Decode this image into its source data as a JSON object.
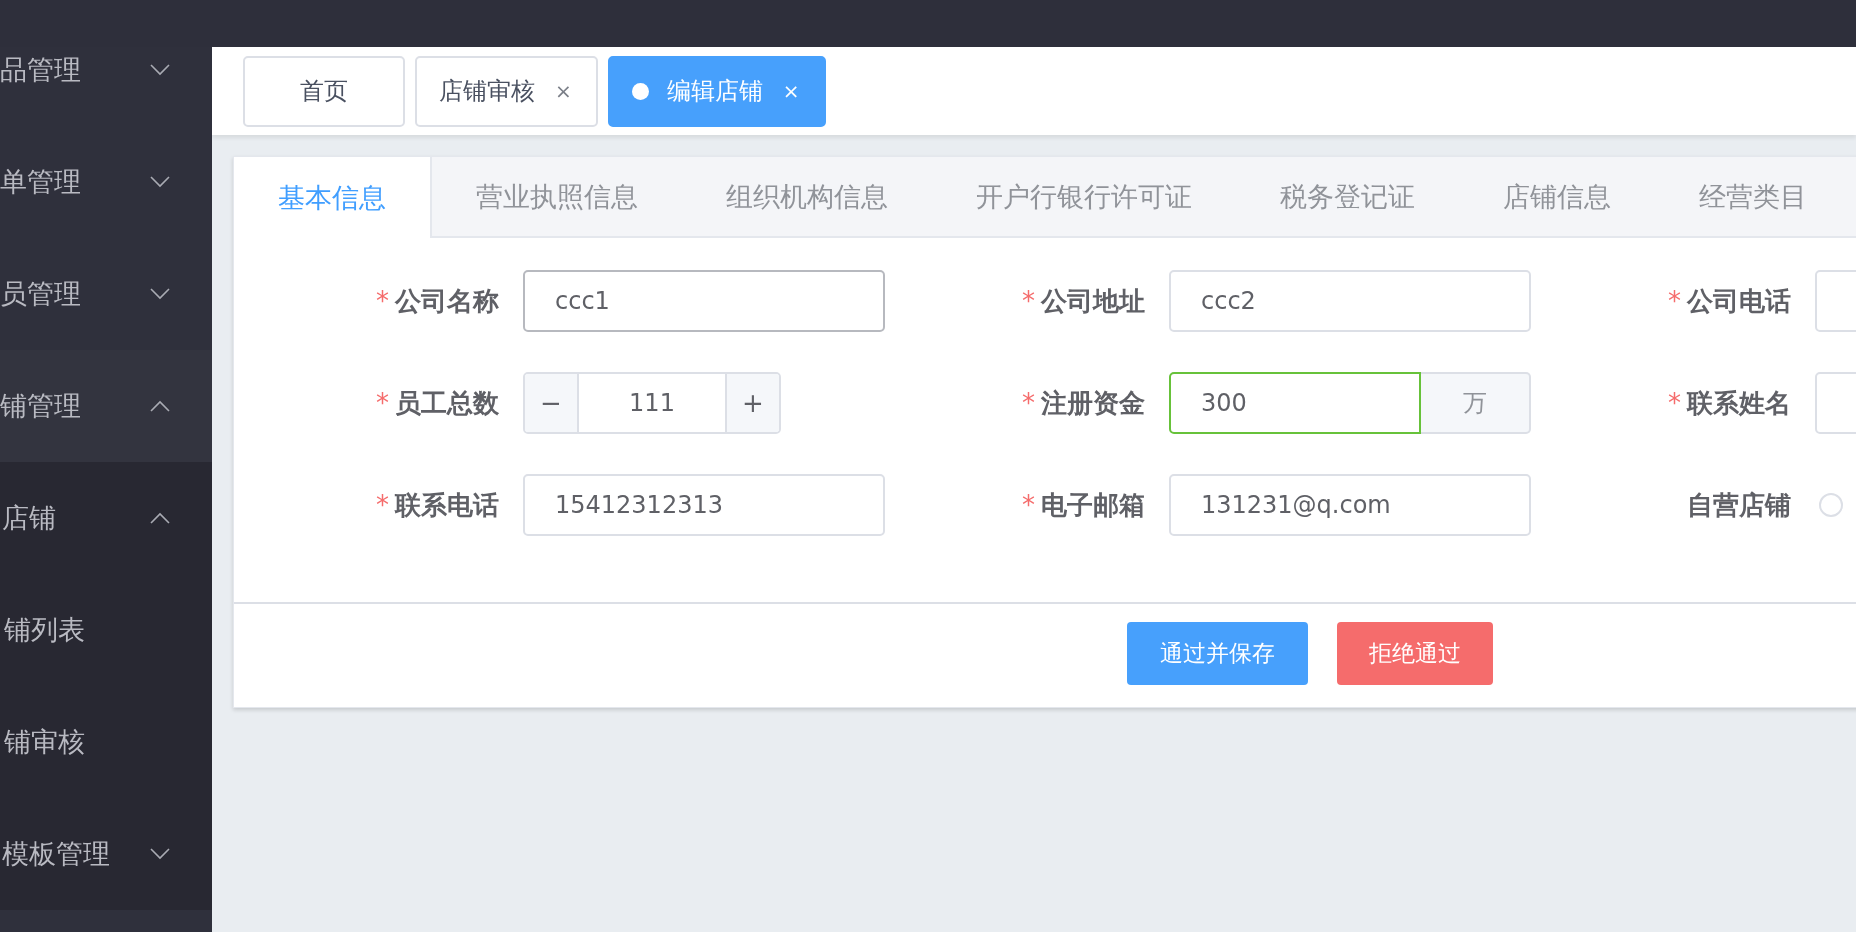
{
  "sidebar": {
    "items": [
      {
        "label": "品管理",
        "expanded": false
      },
      {
        "label": "单管理",
        "expanded": false
      },
      {
        "label": "员管理",
        "expanded": false
      },
      {
        "label": "铺管理",
        "expanded": true,
        "children": [
          {
            "label": "店铺",
            "expanded": true,
            "children": [
              {
                "label": "铺列表"
              },
              {
                "label": "铺审核"
              }
            ]
          },
          {
            "label": "模板管理",
            "expanded": false
          }
        ]
      }
    ]
  },
  "page_tags": [
    {
      "label": "首页",
      "closable": false,
      "selected": false
    },
    {
      "label": "店铺审核",
      "closable": true,
      "selected": false
    },
    {
      "label": "编辑店铺",
      "closable": true,
      "selected": true
    }
  ],
  "close_glyph": "×",
  "tabs": [
    {
      "label": "基本信息",
      "selected": true
    },
    {
      "label": "营业执照信息",
      "selected": false
    },
    {
      "label": "组织机构信息",
      "selected": false
    },
    {
      "label": "开户行银行许可证",
      "selected": false
    },
    {
      "label": "税务登记证",
      "selected": false
    },
    {
      "label": "店铺信息",
      "selected": false
    },
    {
      "label": "经营类目",
      "selected": false
    }
  ],
  "form": {
    "fields": [
      {
        "label": "公司名称",
        "required": true,
        "kind": "text",
        "value": "ccc1",
        "hovered": true
      },
      {
        "label": "公司地址",
        "required": true,
        "kind": "text",
        "value": "ccc2"
      },
      {
        "label": "公司电话",
        "required": true,
        "kind": "text"
      },
      {
        "label": "员工总数",
        "required": true,
        "kind": "number",
        "value": "111",
        "minus": "−",
        "plus": "+"
      },
      {
        "label": "注册资金",
        "required": true,
        "kind": "append",
        "value": "300",
        "append": "万",
        "validated": true
      },
      {
        "label": "联系姓名",
        "required": true,
        "kind": "text"
      },
      {
        "label": "联系电话",
        "required": true,
        "kind": "text",
        "value": "15412312313"
      },
      {
        "label": "电子邮箱",
        "required": true,
        "kind": "text",
        "value": "131231@q.com"
      },
      {
        "label": "自营店铺",
        "required": false,
        "kind": "radio",
        "checked": false
      }
    ],
    "required_mark": "*"
  },
  "buttons": [
    {
      "label": "通过并保存",
      "kind": "primary"
    },
    {
      "label": "拒绝通过",
      "kind": "danger"
    }
  ]
}
